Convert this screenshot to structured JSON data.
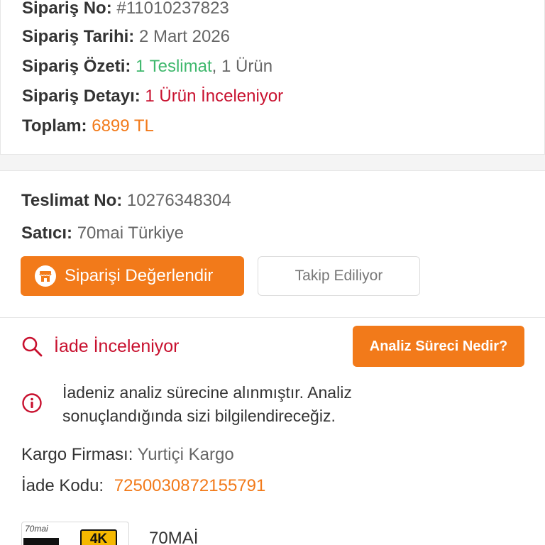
{
  "order": {
    "no_label": "Sipariş No:",
    "no_value": "#11010237823",
    "date_label": "Sipariş Tarihi:",
    "date_value": "2 Mart 2026",
    "summary_label": "Sipariş Özeti:",
    "summary_delivery": "1 Teslimat",
    "summary_sep": ",",
    "summary_items": "1 Ürün",
    "detail_label": "Sipariş Detayı:",
    "detail_value": "1 Ürün İnceleniyor",
    "total_label": "Toplam:",
    "total_value": "6899 TL"
  },
  "delivery": {
    "no_label": "Teslimat No:",
    "no_value": "10276348304",
    "seller_label": "Satıcı:",
    "seller_value": "70mai Türkiye",
    "rate_button": "Siparişi Değerlendir",
    "track_button": "Takip Ediliyor"
  },
  "return": {
    "status": "İade İnceleniyor",
    "analysis_button": "Analiz Süreci Nedir?",
    "info_text": "İadeniz analiz sürecine alınmıştır. Analiz sonuçlandığında sizi bilgilendireceğiz.",
    "cargo_label": "Kargo Firması:",
    "cargo_value": "Yurtiçi Kargo",
    "code_label": "İade Kodu:",
    "code_value": "7250030872155791"
  },
  "product": {
    "thumb_brand": "70mai",
    "thumb_badge": "4K",
    "name": "70MAİ"
  },
  "icons": {
    "shop": "shop-icon",
    "search": "search-icon",
    "info": "info-icon"
  },
  "colors": {
    "accent": "#f27a1a",
    "success": "#3fb86d",
    "alert": "#c8102e"
  }
}
